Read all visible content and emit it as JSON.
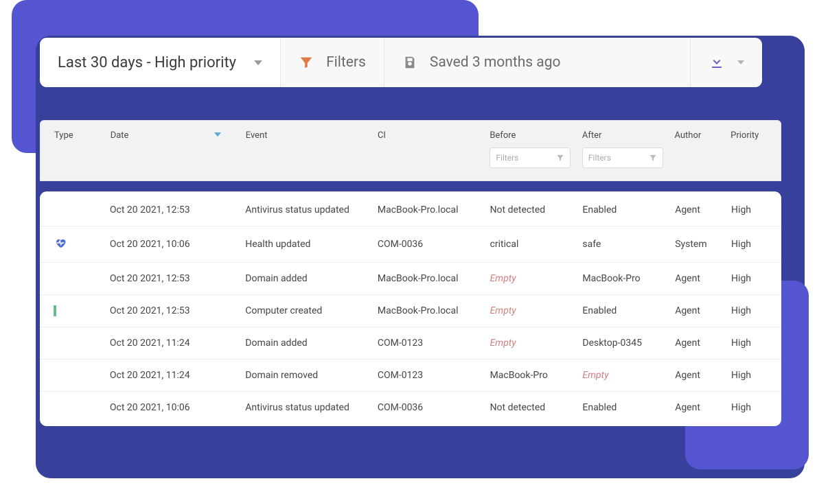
{
  "toolbar": {
    "view_label": "Last 30 days - High priority",
    "filters_label": "Filters",
    "saved_label": "Saved 3 months ago"
  },
  "columns": {
    "type": "Type",
    "date": "Date",
    "event": "Event",
    "ci": "CI",
    "before": "Before",
    "after": "After",
    "author": "Author",
    "priority": "Priority"
  },
  "filter_placeholder": "Filters",
  "empty_label": "Empty",
  "rows": [
    {
      "icon": "tile-blue",
      "date": "Oct 20 2021, 12:53",
      "event": "Antivirus status updated",
      "ci": "MacBook-Pro.local",
      "before": "Not detected",
      "after": "Enabled",
      "author": "Agent",
      "priority": "High"
    },
    {
      "icon": "heart",
      "date": "Oct 20 2021, 10:06",
      "event": "Health updated",
      "ci": "COM-0036",
      "before": "critical",
      "after": "safe",
      "author": "System",
      "priority": "High"
    },
    {
      "icon": "tile-green",
      "date": "Oct 20 2021, 12:53",
      "event": "Domain added",
      "ci": "MacBook-Pro.local",
      "before": "",
      "after": "MacBook-Pro",
      "author": "Agent",
      "priority": "High"
    },
    {
      "icon": "laptop",
      "date": "Oct 20 2021, 12:53",
      "event": "Computer created",
      "ci": "MacBook-Pro.local",
      "before": "",
      "after": "Enabled",
      "author": "Agent",
      "priority": "High"
    },
    {
      "icon": "tile-green",
      "date": "Oct 20 2021, 11:24",
      "event": "Domain added",
      "ci": "COM-0123",
      "before": "",
      "after": "Desktop-0345",
      "author": "Agent",
      "priority": "High"
    },
    {
      "icon": "tile-red",
      "date": "Oct 20 2021, 11:24",
      "event": "Domain removed",
      "ci": "COM-0123",
      "before": "MacBook-Pro",
      "after": "",
      "author": "Agent",
      "priority": "High"
    },
    {
      "icon": "tile-blue",
      "date": "Oct 20 2021, 10:06",
      "event": "Antivirus status updated",
      "ci": "COM-0036",
      "before": "Not detected",
      "after": "Enabled",
      "author": "Agent",
      "priority": "High"
    }
  ]
}
